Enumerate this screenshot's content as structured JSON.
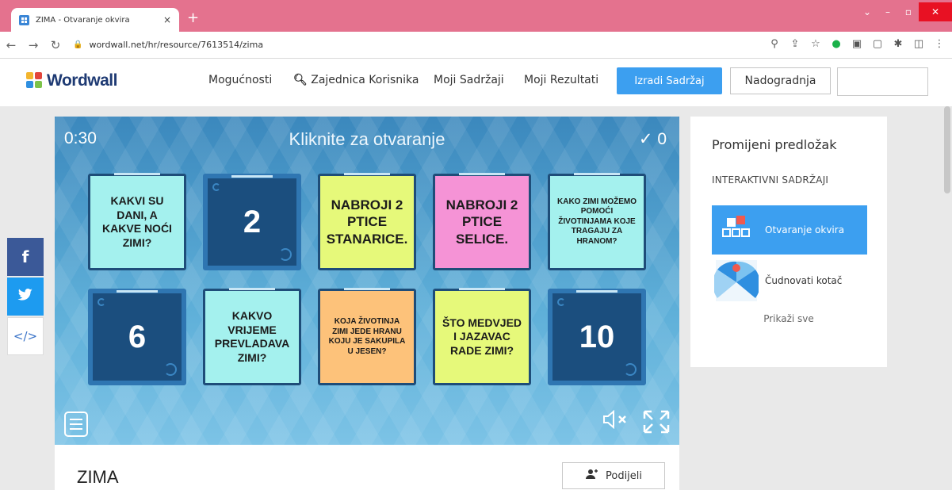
{
  "browser": {
    "tab_title": "ZIMA - Otvaranje okvira",
    "tab_close": "×",
    "new_tab": "+",
    "url": "wordwall.net/hr/resource/7613514/zima",
    "win_menu": "⌄",
    "win_min": "–",
    "win_max": "▫",
    "win_close": "✕"
  },
  "site": {
    "logo": "Wordwall",
    "nav": [
      "Mogućnosti",
      "Zajednica Korisnika",
      "Moji Sadržaji",
      "Moji Rezultati"
    ],
    "create_button": "Izradi Sadržaj",
    "upgrade_button": "Nadogradnja"
  },
  "game": {
    "timer": "0:30",
    "instruction": "Kliknite za otvaranje",
    "score": "✓ 0",
    "boxes": [
      {
        "text": "KAKVI SU DANI, A KAKVE NOĆI ZIMI?",
        "color": "#a4f1ee",
        "kind": "question"
      },
      {
        "text": "2",
        "color": "#1b4e7e",
        "kind": "number"
      },
      {
        "text": "NABROJI 2 PTICE STANARICE.",
        "color": "#e6f97a",
        "kind": "question"
      },
      {
        "text": "NABROJI 2 PTICE SELICE.",
        "color": "#f593d6",
        "kind": "question"
      },
      {
        "text": "KAKO ZIMI MOŽEMO POMOĆI ŽIVOTINJAMA KOJE TRAGAJU ZA HRANOM?",
        "color": "#a4f1ee",
        "kind": "question"
      },
      {
        "text": "6",
        "color": "#1b4e7e",
        "kind": "number"
      },
      {
        "text": "KAKVO VRIJEME PREVLADAVA ZIMI?",
        "color": "#a4f1ee",
        "kind": "question"
      },
      {
        "text": "KOJA ŽIVOTINJA ZIMI JEDE HRANU KOJU JE SAKUPILA U JESEN?",
        "color": "#fdc27a",
        "kind": "question"
      },
      {
        "text": "ŠTO MEDVJED I JAZAVAC RADE ZIMI?",
        "color": "#e6f97a",
        "kind": "question"
      },
      {
        "text": "10",
        "color": "#1b4e7e",
        "kind": "number"
      }
    ],
    "mute_icon": "🔇",
    "fullscreen_icon": "⤡"
  },
  "panel": {
    "title": "Promijeni predložak",
    "subtitle": "INTERAKTIVNI SADRŽAJI",
    "templates": [
      {
        "label": "Otvaranje okvira",
        "active": true
      },
      {
        "label": "Čudnovati kotač",
        "active": false
      }
    ],
    "show_all": "Prikaži sve"
  },
  "activity": {
    "title": "ZIMA",
    "share_button": "Podijeli"
  },
  "social": {
    "facebook": "f",
    "twitter": "🐦",
    "embed": "</>"
  }
}
